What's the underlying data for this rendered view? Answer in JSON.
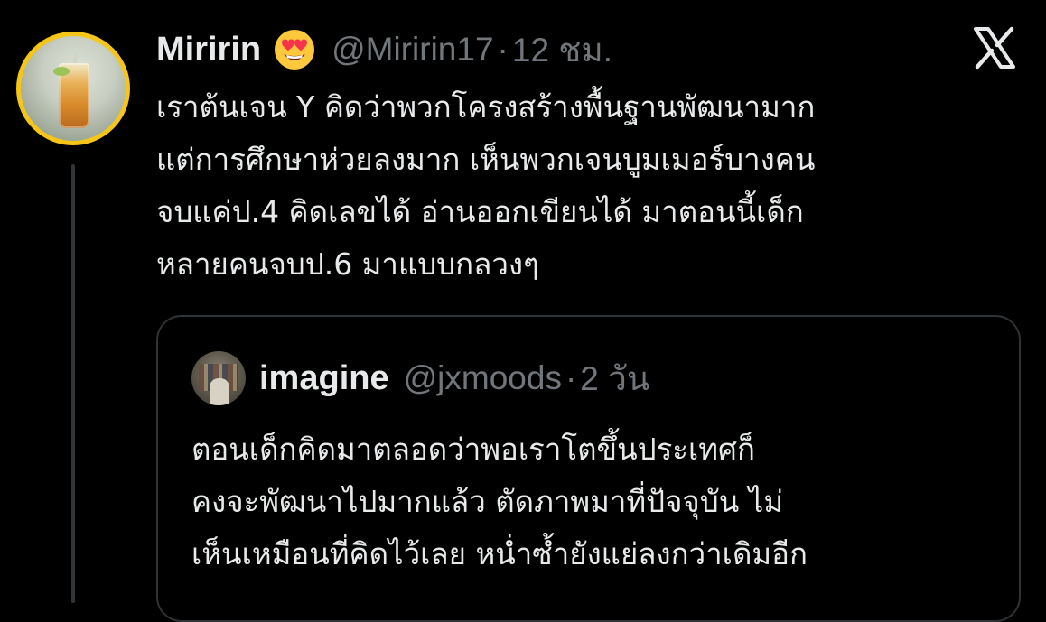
{
  "tweet": {
    "author": {
      "name": "Miririn",
      "emoji": "heart-eyes-emoji",
      "handle": "@Miririn17",
      "separator": "·",
      "time": "12 ชม."
    },
    "platform_icon": "x-logo-icon",
    "text_lines": [
      "เราต้นเจน Y คิดว่าพวกโครงสร้างพื้นฐานพัฒนามาก",
      "แต่การศึกษาห่วยลงมาก เห็นพวกเจนบูมเมอร์บางคน",
      "จบแค่ป.4 คิดเลขได้ อ่านออกเขียนได้ มาตอนนี้เด็ก",
      "หลายคนจบป.6 มาแบบกลวงๆ"
    ]
  },
  "quoted_tweet": {
    "author": {
      "name": "imagine",
      "handle": "@jxmoods",
      "separator": "·",
      "time": "2 วัน"
    },
    "text_lines": [
      "ตอนเด็กคิดมาตลอดว่าพอเราโตขึ้นประเทศก็",
      "คงจะพัฒนาไปมากแล้ว ตัดภาพมาที่ปัจจุบัน ไม่",
      "เห็นเหมือนที่คิดไว้เลย หน่ำซ้ำยังแย่ลงกว่าเดิมอีก"
    ]
  },
  "colors": {
    "background": "#000000",
    "primary_text": "#e7e9ea",
    "secondary_text": "#71767b",
    "border": "#2f3336",
    "avatar_ring": "#f5c518"
  }
}
